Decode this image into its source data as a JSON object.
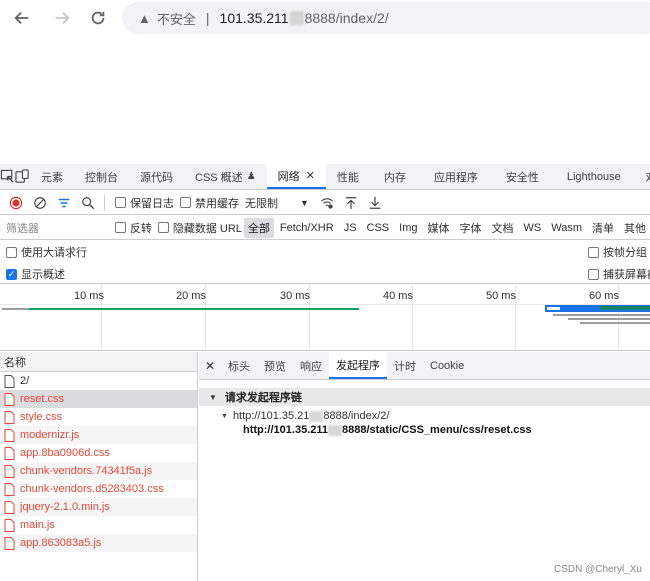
{
  "browser": {
    "nav": {
      "back_icon": "arrow-left-icon",
      "forward_icon": "arrow-right-icon",
      "reload_icon": "reload-icon"
    },
    "security_label": "不安全",
    "url_host": "101.35.211",
    "url_rest": "8888/index/2/"
  },
  "devtools": {
    "tabs": [
      {
        "label": "元素"
      },
      {
        "label": "控制台"
      },
      {
        "label": "源代码"
      },
      {
        "label": "CSS 概述"
      },
      {
        "label": "网络",
        "active": true
      },
      {
        "label": "性能"
      },
      {
        "label": "内存"
      },
      {
        "label": "应用程序"
      },
      {
        "label": "安全性"
      },
      {
        "label": "Lighthouse"
      },
      {
        "label": "欢迎"
      }
    ],
    "toolbar": {
      "preserve_log": "保留日志",
      "disable_cache": "禁用缓存",
      "throttling": "无限制"
    },
    "filter": {
      "placeholder": "筛选器",
      "invert": "反转",
      "hide_data_urls": "隐藏数据 URL",
      "types": [
        "全部",
        "Fetch/XHR",
        "JS",
        "CSS",
        "Img",
        "媒体",
        "字体",
        "文档",
        "WS",
        "Wasm",
        "清单",
        "其他"
      ]
    },
    "options": {
      "large_rows": "使用大请求行",
      "show_overview": "显示概述",
      "group_by_frame": "按帧分组",
      "capture_screenshots": "捕获屏幕截"
    },
    "overview": {
      "ticks": [
        "10 ms",
        "20 ms",
        "30 ms",
        "40 ms",
        "50 ms",
        "60 ms"
      ]
    },
    "requests": {
      "header": "名称",
      "rows": [
        {
          "name": "2/",
          "error": false
        },
        {
          "name": "reset.css",
          "error": true,
          "selected": true
        },
        {
          "name": "style.css",
          "error": true
        },
        {
          "name": "modernizr.js",
          "error": true
        },
        {
          "name": "app.8ba0906d.css",
          "error": true
        },
        {
          "name": "chunk-vendors.74341f5a.js",
          "error": true
        },
        {
          "name": "chunk-vendors.d5283403.css",
          "error": true
        },
        {
          "name": "jquery-2.1.0.min.js",
          "error": true
        },
        {
          "name": "main.js",
          "error": true
        },
        {
          "name": "app.863083a5.js",
          "error": true
        }
      ]
    },
    "detail": {
      "tabs": [
        "标头",
        "预览",
        "响应",
        "发起程序",
        "计时",
        "Cookie"
      ],
      "active_tab": "发起程序",
      "section_title": "请求发起程序链",
      "chain_parent_a": "http://101.35.21",
      "chain_parent_b": "8888/index/2/",
      "chain_child_a": "http://101.35.211",
      "chain_child_b": "8888/static/CSS_menu/css/reset.css"
    }
  },
  "watermark": "CSDN @Cheryl_Xu",
  "colors": {
    "accent": "#1a73e8",
    "error_text": "#e8473a",
    "record_red": "#d93025"
  }
}
